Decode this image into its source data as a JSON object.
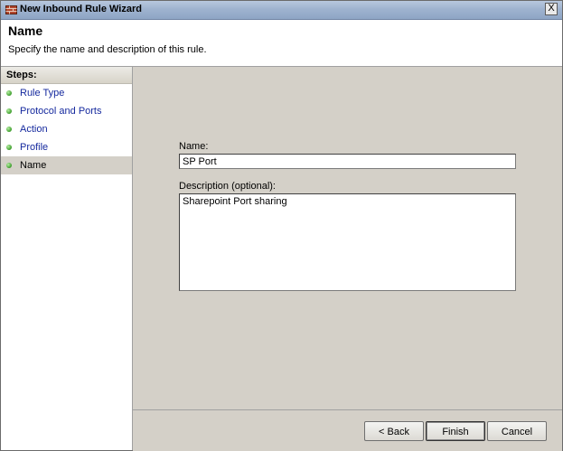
{
  "window": {
    "title": "New Inbound Rule Wizard",
    "icon": "firewall-wizard-icon",
    "close_label": "X"
  },
  "header": {
    "title": "Name",
    "subtitle": "Specify the name and description of this rule."
  },
  "steps": {
    "heading": "Steps:",
    "items": [
      {
        "label": "Rule Type",
        "current": false
      },
      {
        "label": "Protocol and Ports",
        "current": false
      },
      {
        "label": "Action",
        "current": false
      },
      {
        "label": "Profile",
        "current": false
      },
      {
        "label": "Name",
        "current": true
      }
    ]
  },
  "form": {
    "name_label": "Name:",
    "name_value": "SP Port",
    "description_label": "Description (optional):",
    "description_value": "Sharepoint Port sharing"
  },
  "buttons": {
    "back": "< Back",
    "finish": "Finish",
    "cancel": "Cancel"
  },
  "colors": {
    "step_link": "#15299e",
    "step_dot": "#3c9c2b",
    "dialog_bg": "#d4d0c8"
  }
}
